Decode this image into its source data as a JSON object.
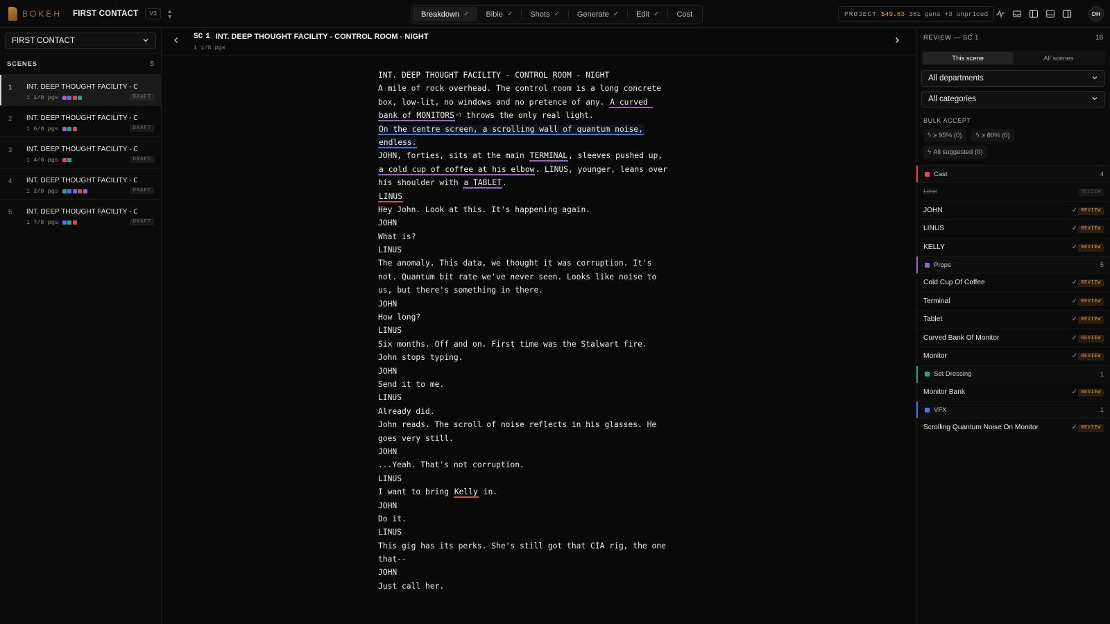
{
  "topbar": {
    "brand": "BOKEH",
    "project_name": "FIRST CONTACT",
    "version": "V3",
    "tabs": [
      {
        "label": "Breakdown",
        "checked": true,
        "active": true
      },
      {
        "label": "Bible",
        "checked": true
      },
      {
        "label": "Shots",
        "checked": true
      },
      {
        "label": "Generate",
        "checked": true
      },
      {
        "label": "Edit",
        "checked": true
      },
      {
        "label": "Cost",
        "checked": false
      }
    ],
    "check_glyph": "✓",
    "project_label": "PROJECT",
    "project_amount": "$49.63",
    "project_detail": "361 gens +3 unpriced",
    "user_initials": "DH",
    "icons": [
      "activity-icon",
      "inbox-icon",
      "left-panel-icon",
      "bottom-panel-icon",
      "right-panel-icon"
    ]
  },
  "sidebar": {
    "project_select": "FIRST CONTACT",
    "scenes_label": "SCENES",
    "scenes_count": "5",
    "scenes": [
      {
        "num": "1",
        "title": "INT. DEEP THOUGHT FACILITY - C...",
        "pages": "1 1/8 pgs",
        "swatches": [
          "#9a62d0",
          "#6a6ae0",
          "#e04848",
          "#21a58c"
        ],
        "status": "DRAFT",
        "active": true
      },
      {
        "num": "2",
        "title": "INT. DEEP THOUGHT FACILITY - C...",
        "pages": "1 6/8 pgs",
        "swatches": [
          "#9a62d0",
          "#21a58c",
          "#e04848"
        ],
        "status": "DRAFT"
      },
      {
        "num": "3",
        "title": "INT. DEEP THOUGHT FACILITY - C...",
        "pages": "1 4/8 pgs",
        "swatches": [
          "#e04848",
          "#21a58c"
        ],
        "status": "DRAFT"
      },
      {
        "num": "4",
        "title": "INT. DEEP THOUGHT FACILITY - C...",
        "pages": "1 2/8 pgs",
        "swatches": [
          "#21a58c",
          "#3f7be0",
          "#6a6ae0",
          "#e04848",
          "#9a62d0"
        ],
        "status": "DRAFT"
      },
      {
        "num": "5",
        "title": "INT. DEEP THOUGHT FACILITY - C...",
        "pages": "1 7/8 pgs",
        "swatches": [
          "#3f7be0",
          "#21a58c",
          "#e04848"
        ],
        "status": "DRAFT"
      }
    ]
  },
  "main": {
    "sc_label": "SC",
    "sc_number": "1",
    "sc_heading": "INT. DEEP THOUGHT FACILITY - CONTROL ROOM - NIGHT",
    "sc_pages": "1 1/8 pgs",
    "script_lines": [
      [
        {
          "t": "INT. DEEP THOUGHT FACILITY - CONTROL ROOM - NIGHT"
        }
      ],
      [
        {
          "t": "A mile of rock overhead. The control room is a long concrete"
        }
      ],
      [
        {
          "t": "box, low-lit, no windows and no pretence of any. "
        },
        {
          "t": "A curved ",
          "tag": "props"
        }
      ],
      [
        {
          "t": "bank of MONITORS",
          "tag": "props"
        },
        {
          "t": "+1",
          "sup": true
        },
        {
          "t": " throws the only real light."
        }
      ],
      [
        {
          "t": "On the centre screen, a scrolling wall of quantum noise,",
          "tag": "vfx"
        }
      ],
      [
        {
          "t": "endless.",
          "tag": "vfx"
        }
      ],
      [
        {
          "t": "JOHN, forties, sits at the main "
        },
        {
          "t": "TERMINAL",
          "tag": "props"
        },
        {
          "t": ", sleeves pushed up,"
        }
      ],
      [
        {
          "t": "a cold cup of coffee at his elbow",
          "tag": "props"
        },
        {
          "t": ". LINUS, younger, leans over"
        }
      ],
      [
        {
          "t": "his shoulder with "
        },
        {
          "t": "a TABLET",
          "tag": "props"
        },
        {
          "t": "."
        }
      ],
      [
        {
          "t": "LINUS",
          "tag": "cast"
        }
      ],
      [
        {
          "t": "Hey John. Look at this. It's happening again."
        }
      ],
      [
        {
          "t": "JOHN"
        }
      ],
      [
        {
          "t": "What is?"
        }
      ],
      [
        {
          "t": "LINUS"
        }
      ],
      [
        {
          "t": "The anomaly. This data, we thought it was corruption. It's"
        }
      ],
      [
        {
          "t": "not. Quantum bit rate we've never seen. Looks like noise to"
        }
      ],
      [
        {
          "t": "us, but there's something in there."
        }
      ],
      [
        {
          "t": "JOHN"
        }
      ],
      [
        {
          "t": "How long?"
        }
      ],
      [
        {
          "t": "LINUS"
        }
      ],
      [
        {
          "t": "Six months. Off and on. First time was the Stalwart fire."
        }
      ],
      [
        {
          "t": "John stops typing."
        }
      ],
      [
        {
          "t": "JOHN"
        }
      ],
      [
        {
          "t": "Send it to me."
        }
      ],
      [
        {
          "t": "LINUS"
        }
      ],
      [
        {
          "t": "Already did."
        }
      ],
      [
        {
          "t": "John reads. The scroll of noise reflects in his glasses. He"
        }
      ],
      [
        {
          "t": "goes very still."
        }
      ],
      [
        {
          "t": "JOHN"
        }
      ],
      [
        {
          "t": "...Yeah. That's not corruption."
        }
      ],
      [
        {
          "t": "LINUS"
        }
      ],
      [
        {
          "t": "I want to bring "
        },
        {
          "t": "Kelly",
          "tag": "cast"
        },
        {
          "t": " in."
        }
      ],
      [
        {
          "t": "JOHN"
        }
      ],
      [
        {
          "t": "Do it."
        }
      ],
      [
        {
          "t": "LINUS"
        }
      ],
      [
        {
          "t": "This gig has its perks. She's still got that CIA rig, the one"
        }
      ],
      [
        {
          "t": "that--"
        }
      ],
      [
        {
          "t": "JOHN"
        }
      ],
      [
        {
          "t": "Just call her."
        }
      ]
    ]
  },
  "review": {
    "title": "REVIEW — SC 1",
    "count": "18",
    "scope_tabs": [
      {
        "label": "This scene",
        "active": true
      },
      {
        "label": "All scenes"
      }
    ],
    "department_select": "All departments",
    "category_select": "All categories",
    "bulk_label": "BULK ACCEPT",
    "bulk_buttons": [
      "≥ 95% (0)",
      "≥ 80% (0)",
      "All suggested (0)"
    ],
    "status_label": "REVIEW",
    "categories": [
      {
        "name": "Cast",
        "count": "4",
        "color": "#e04848",
        "items": [
          {
            "name": "Linu",
            "struck": true
          },
          {
            "name": "JOHN"
          },
          {
            "name": "LINUS"
          },
          {
            "name": "KELLY"
          }
        ]
      },
      {
        "name": "Props",
        "count": "5",
        "color": "#9a62d0",
        "items": [
          {
            "name": "Cold Cup Of Coffee"
          },
          {
            "name": "Terminal"
          },
          {
            "name": "Tablet"
          },
          {
            "name": "Curved Bank Of Monitor"
          },
          {
            "name": "Monitor"
          }
        ]
      },
      {
        "name": "Set Dressing",
        "count": "1",
        "color": "#21a58c",
        "items": [
          {
            "name": "Monitor Bank"
          }
        ]
      },
      {
        "name": "VFX",
        "count": "1",
        "color": "#3f7be0",
        "items": [
          {
            "name": "Scrolling Quantum Noise On Monitor"
          }
        ]
      }
    ]
  }
}
